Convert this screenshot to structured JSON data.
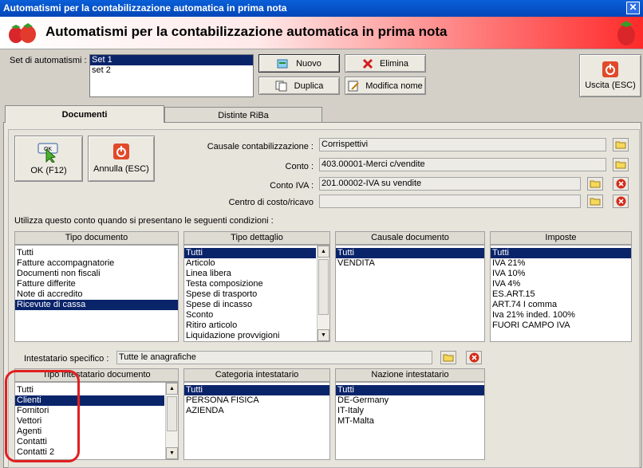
{
  "window": {
    "title": "Automatismi per la contabilizzazione automatica in prima nota",
    "close_symbol": "✕"
  },
  "banner": {
    "title": "Automatismi per la contabilizzazione automatica in prima nota"
  },
  "set": {
    "label": "Set di automatismi :",
    "items": [
      "Set 1",
      "set 2"
    ],
    "selected": 0
  },
  "toolbar": {
    "nuovo": "Nuovo",
    "elimina": "Elimina",
    "duplica": "Duplica",
    "modifica_nome": "Modifica nome",
    "uscita": "Uscita (ESC)"
  },
  "tabs": {
    "documenti": "Documenti",
    "distinte": "Distinte RiBa"
  },
  "actions": {
    "ok": "OK (F12)",
    "ok_icon_text": "OK",
    "annulla": "Annulla (ESC)"
  },
  "fields": {
    "causale_label": "Causale contabilizzazione :",
    "causale_value": "Corrispettivi",
    "conto_label": "Conto :",
    "conto_value": "403.00001-Merci c/vendite",
    "contoiva_label": "Conto IVA :",
    "contoiva_value": "201.00002-IVA su vendite",
    "centro_label": "Centro di costo/ricavo",
    "centro_value": ""
  },
  "conditions_label": "Utilizza questo conto quando si presentano le seguenti condizioni :",
  "tipo_documento": {
    "header": "Tipo documento",
    "items": [
      "Tutti",
      "Fatture accompagnatorie",
      "Documenti non fiscali",
      "Fatture differite",
      "Note di accredito",
      "Ricevute di cassa"
    ],
    "selected": 5
  },
  "tipo_dettaglio": {
    "header": "Tipo dettaglio",
    "items": [
      "Tutti",
      "Articolo",
      "Linea libera",
      "Testa composizione",
      "Spese di trasporto",
      "Spese di incasso",
      "Sconto",
      "Ritiro articolo",
      "Liquidazione provvigioni"
    ],
    "selected": 0
  },
  "causale_documento": {
    "header": "Causale documento",
    "items": [
      "Tutti",
      "VENDITA"
    ],
    "selected": 0
  },
  "imposte": {
    "header": "Imposte",
    "items": [
      "Tutti",
      "IVA 21%",
      "IVA 10%",
      "IVA 4%",
      "ES.ART.15",
      "ART.74 I comma",
      "Iva 21% inded. 100%",
      "FUORI CAMPO IVA"
    ],
    "selected": 0
  },
  "intestatario": {
    "label": "Intestatario specifico :",
    "value": "Tutte le anagrafiche"
  },
  "tipo_intestatario": {
    "header": "Tipo intestatario documento",
    "items": [
      "Tutti",
      "Clienti",
      "Fornitori",
      "Vettori",
      "Agenti",
      "Contatti",
      "Contatti 2"
    ],
    "selected": 1
  },
  "categoria_intestatario": {
    "header": "Categoria intestatario",
    "items": [
      "Tutti",
      "PERSONA FISICA",
      "AZIENDA"
    ],
    "selected": 0
  },
  "nazione_intestatario": {
    "header": "Nazione intestatario",
    "items": [
      "Tutti",
      "DE-Germany",
      "IT-Italy",
      "MT-Malta"
    ],
    "selected": 0
  },
  "colors": {
    "title_blue": "#0346b8",
    "selection": "#0a246a",
    "annotation_red": "#e02020"
  }
}
